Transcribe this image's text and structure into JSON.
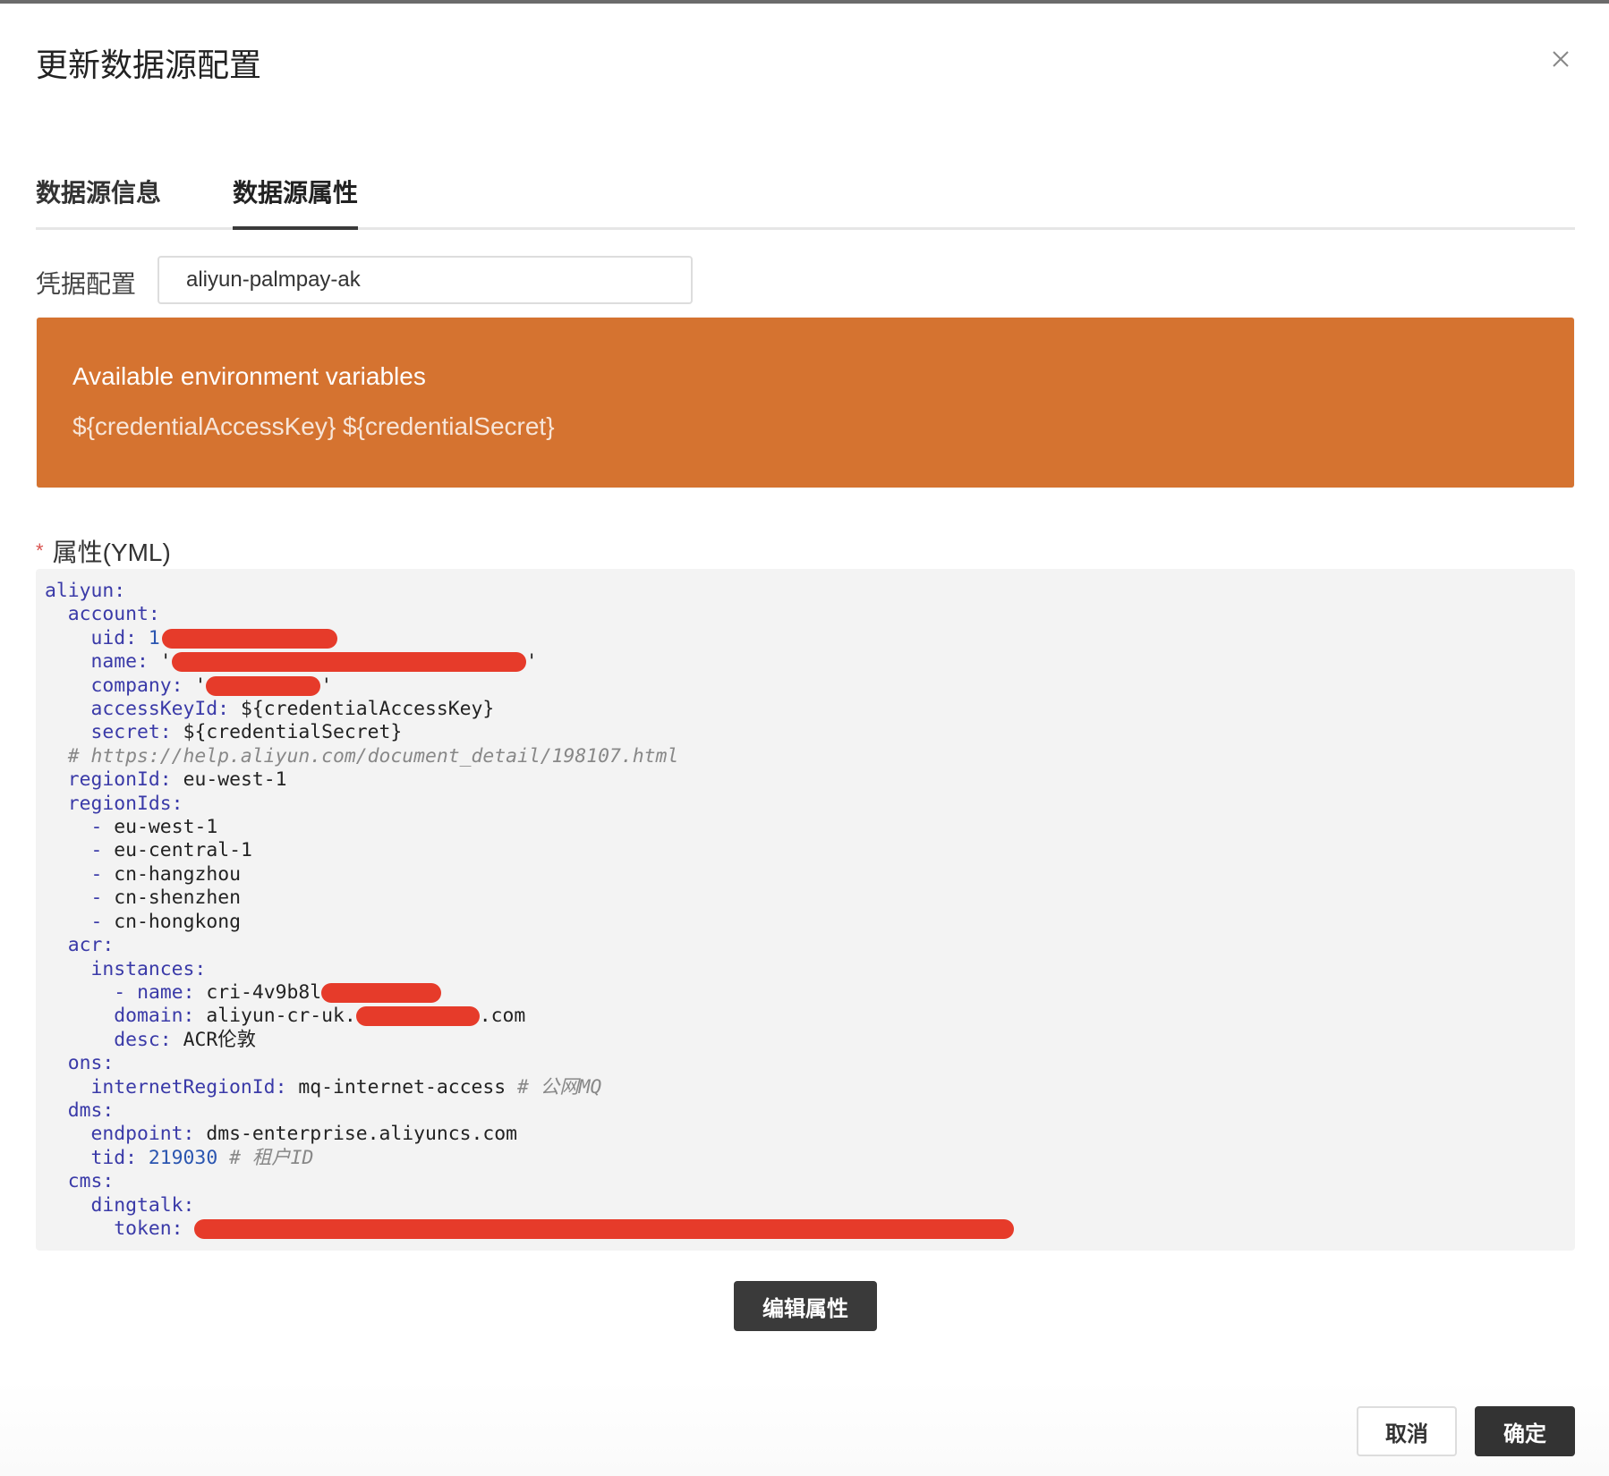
{
  "dialog": {
    "title": "更新数据源配置",
    "close_icon": "close-icon"
  },
  "tabs": [
    {
      "label": "数据源信息"
    },
    {
      "label": "数据源属性"
    }
  ],
  "credential": {
    "label": "凭据配置",
    "value": "aliyun-palmpay-ak"
  },
  "banner": {
    "heading": "Available environment variables",
    "vars": "${credentialAccessKey} ${credentialSecret}",
    "color": "#d57330"
  },
  "yml": {
    "label": "属性(YML)",
    "required_mark": "*",
    "lines": {
      "l1": "aliyun:",
      "l2": "  account:",
      "l3_key": "    uid:",
      "l3_val": "1",
      "l4_key": "    name:",
      "l4_val_start": "'",
      "l4_val_end": "'",
      "l5_key": "    company:",
      "l5_val_start": "'",
      "l5_val_end": "'",
      "l6_key": "    accessKeyId:",
      "l6_val": "${credentialAccessKey}",
      "l7_key": "    secret:",
      "l7_val": "${credentialSecret}",
      "l8_comment": "  # https://help.aliyun.com/document_detail/198107.html",
      "l9_key": "  regionId:",
      "l9_val": "eu-west-1",
      "l10_key": "  regionIds:",
      "l11": "eu-west-1",
      "l12": "eu-central-1",
      "l13": "cn-hangzhou",
      "l14": "cn-shenzhen",
      "l15": "cn-hongkong",
      "l16_key": "  acr:",
      "l17_key": "    instances:",
      "l18_key": "name:",
      "l18_val": "cri-4v9b8l",
      "l19_key": "      domain:",
      "l19_val_start": "aliyun-cr-uk.",
      "l19_val_end": ".com",
      "l20_key": "      desc:",
      "l20_val": "ACR伦敦",
      "l21_key": "  ons:",
      "l22_key": "    internetRegionId:",
      "l22_val": "mq-internet-access",
      "l22_comment": "# 公网MQ",
      "l23_key": "  dms:",
      "l24_key": "    endpoint:",
      "l24_val": "dms-enterprise.aliyuncs.com",
      "l25_key": "    tid:",
      "l25_val": "219030",
      "l25_comment": "# 租户ID",
      "l26_key": "  cms:",
      "l27_key": "    dingtalk:",
      "l28_key": "      token:"
    }
  },
  "buttons": {
    "edit": "编辑属性",
    "cancel": "取消",
    "ok": "确定"
  }
}
